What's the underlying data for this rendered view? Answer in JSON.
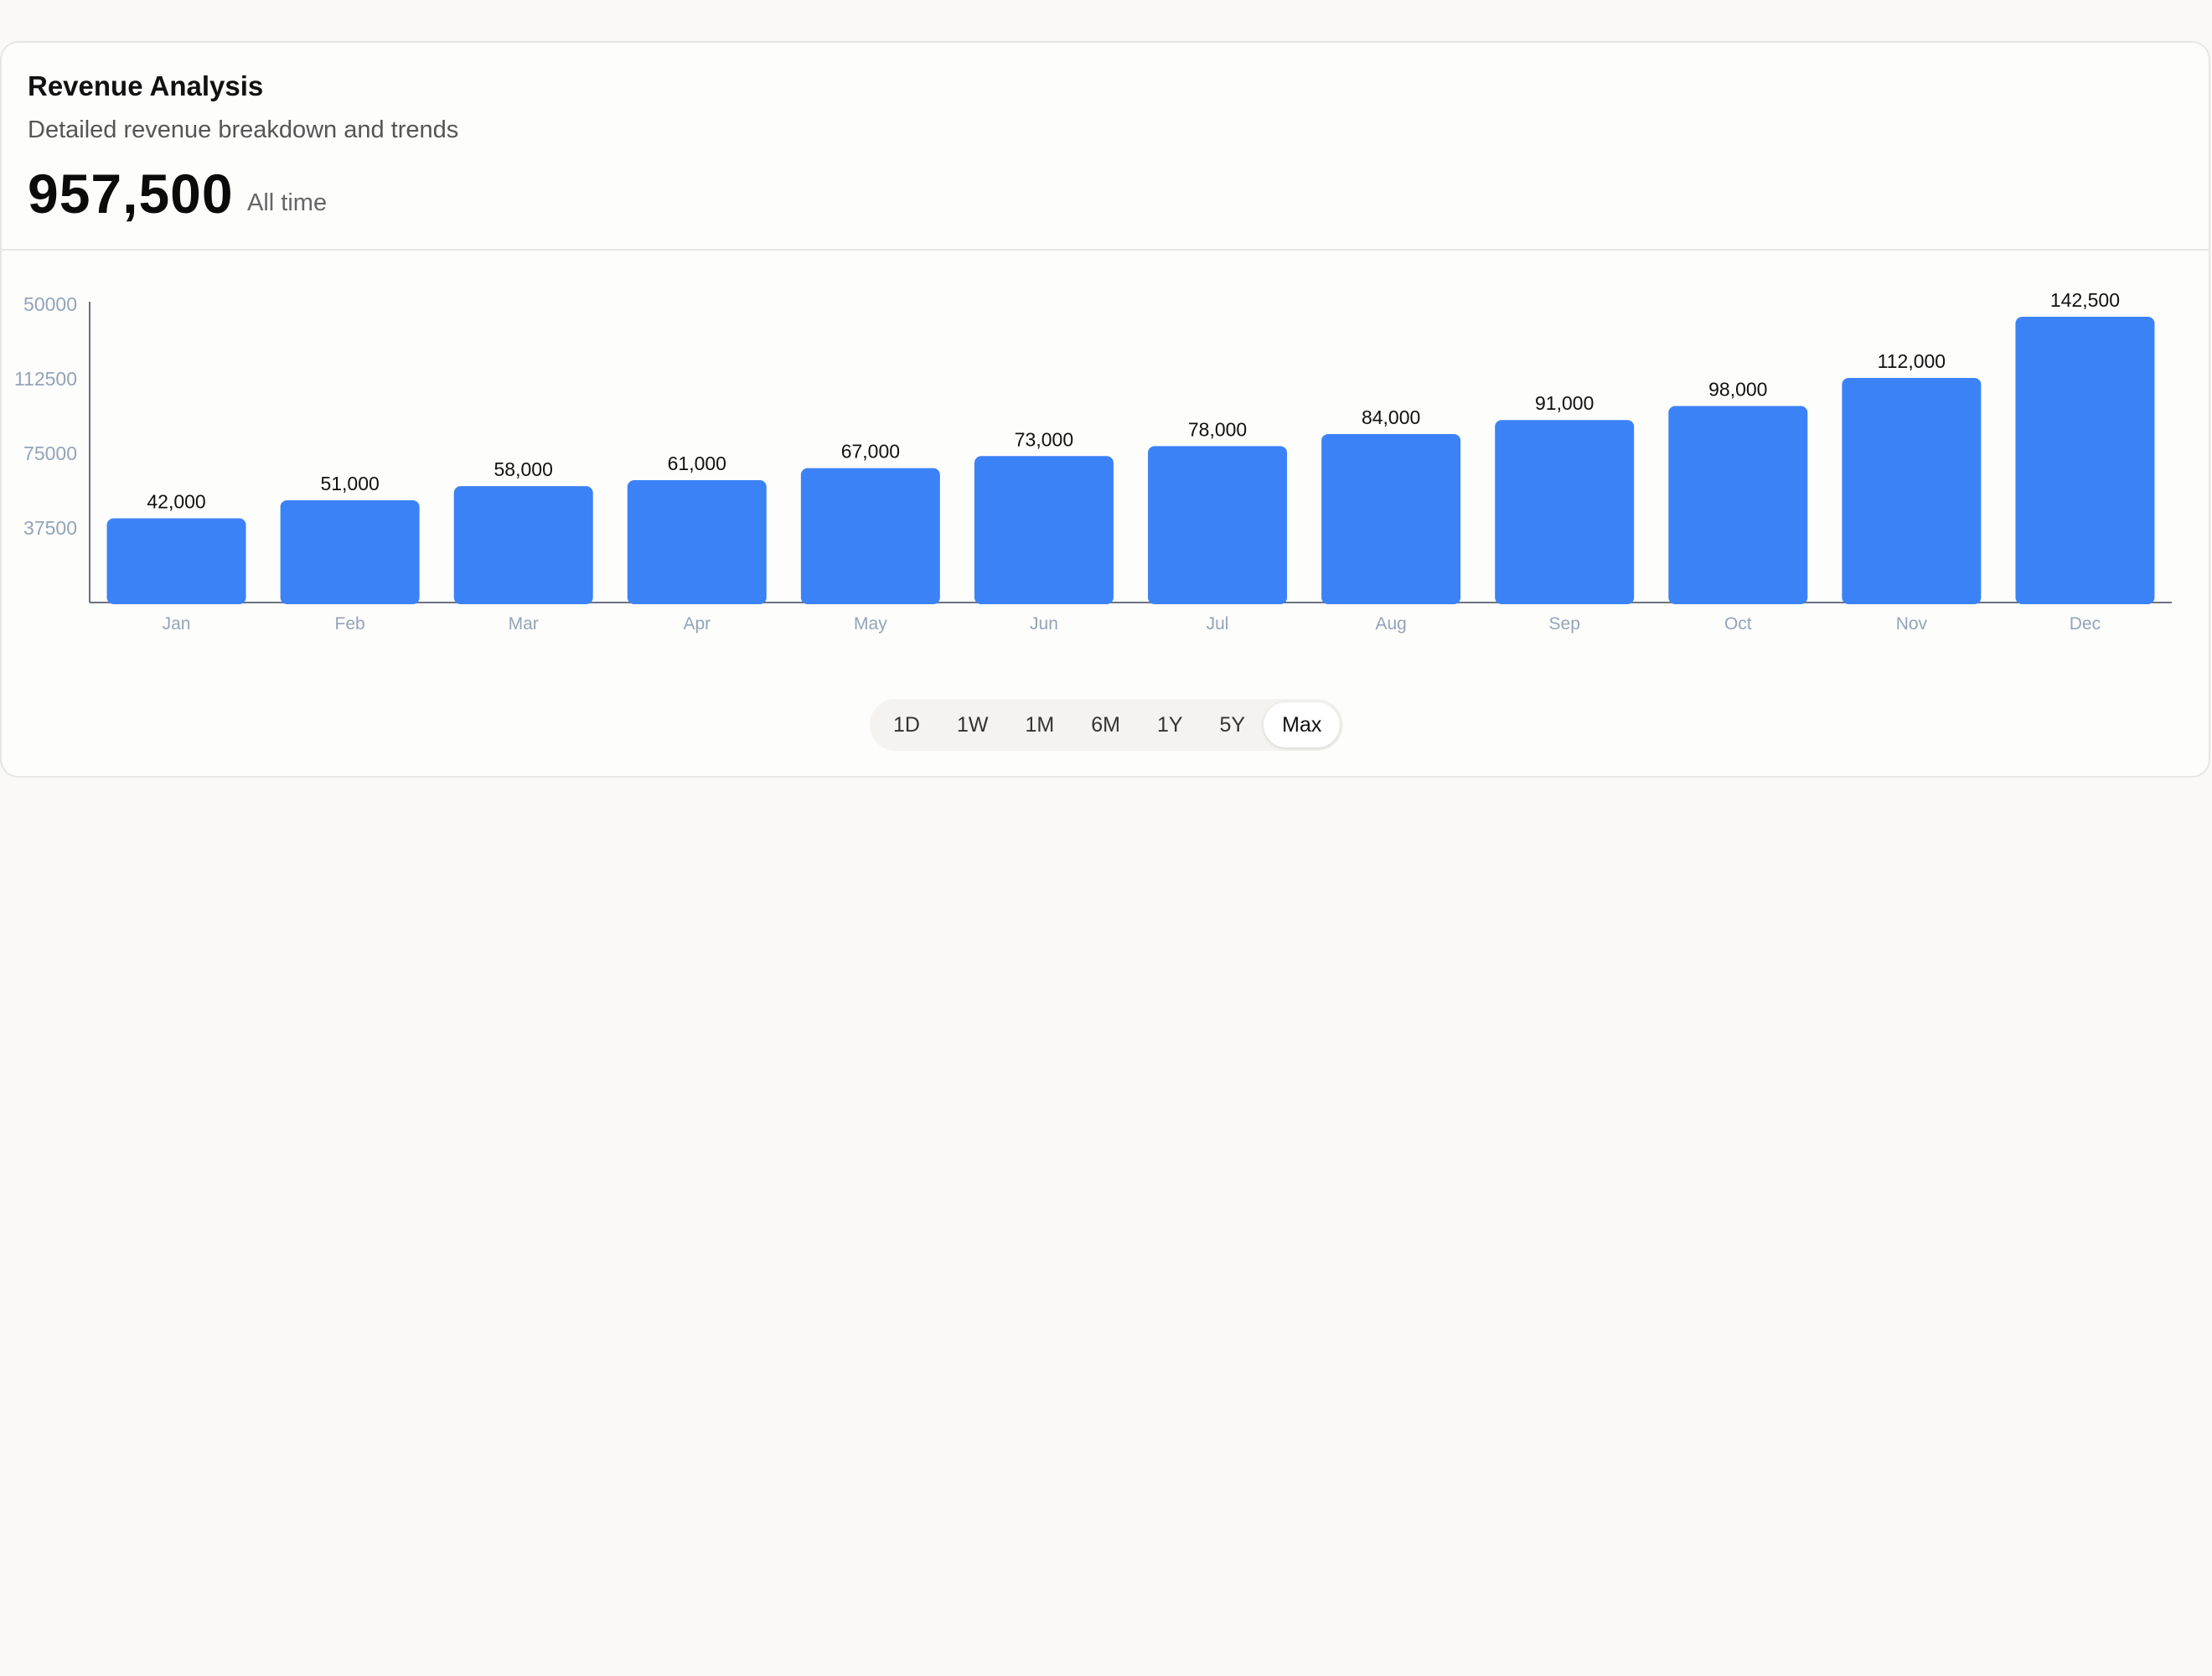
{
  "card": {
    "title": "Revenue Analysis",
    "subtitle": "Detailed revenue breakdown and trends",
    "total": "957,500",
    "total_caption": "All time"
  },
  "range_selector": {
    "options": [
      "1D",
      "1W",
      "1M",
      "6M",
      "1Y",
      "5Y",
      "Max"
    ],
    "selected": "Max"
  },
  "colors": {
    "bar": "#3b82f6",
    "axis_text": "#94a3b8",
    "value_label": "#111111"
  },
  "chart_data": {
    "type": "bar",
    "categories": [
      "Jan",
      "Feb",
      "Mar",
      "Apr",
      "May",
      "Jun",
      "Jul",
      "Aug",
      "Sep",
      "Oct",
      "Nov",
      "Dec"
    ],
    "values": [
      42000,
      51000,
      58000,
      61000,
      67000,
      73000,
      78000,
      84000,
      91000,
      98000,
      112000,
      142500
    ],
    "value_labels": [
      "42,000",
      "51,000",
      "58,000",
      "61,000",
      "67,000",
      "73,000",
      "78,000",
      "84,000",
      "91,000",
      "98,000",
      "112,000",
      "142,500"
    ],
    "y_tick_labels": [
      "50000",
      "112500",
      "75000",
      "37500"
    ],
    "ylim": [
      0,
      150000
    ],
    "grid": false,
    "legend": "none"
  }
}
